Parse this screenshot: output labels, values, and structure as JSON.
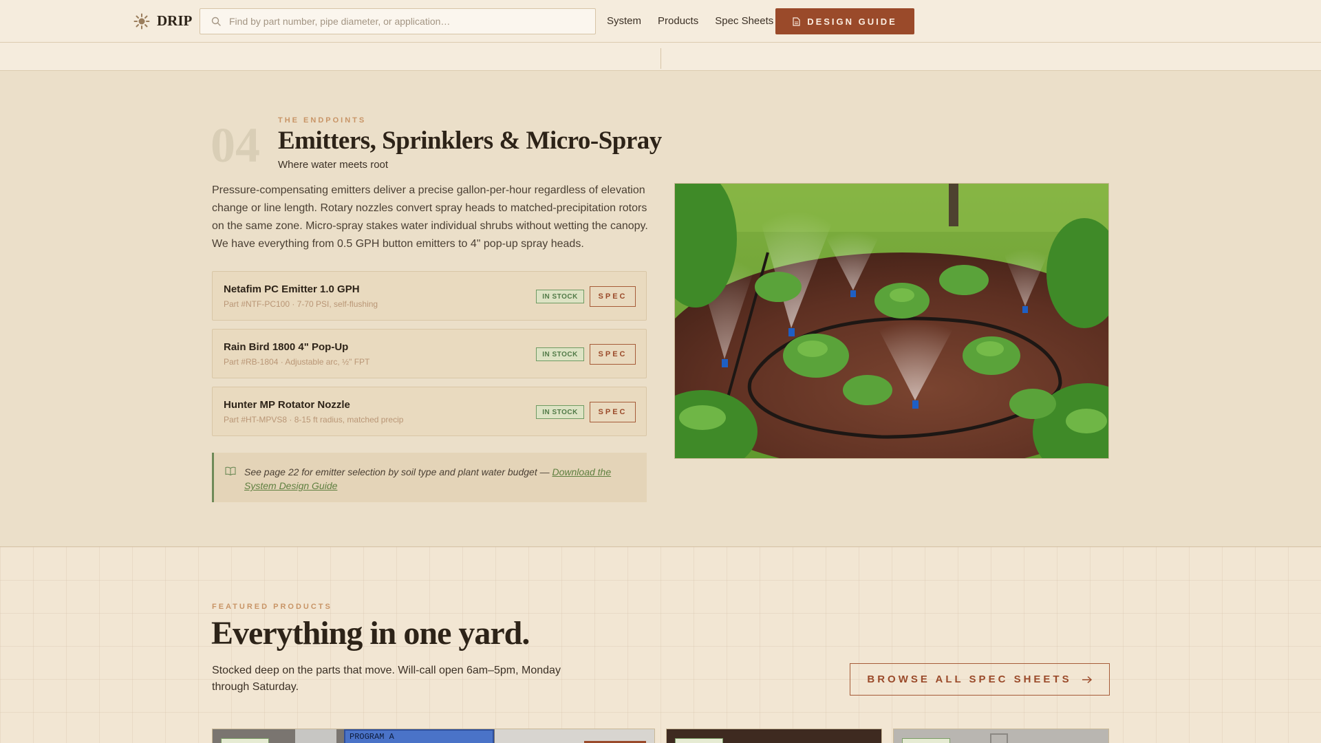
{
  "header": {
    "logo_text": "DRIP",
    "search_placeholder": "Find by part number, pipe diameter, or application…",
    "nav": [
      "System",
      "Products",
      "Spec Sheets"
    ],
    "cta_label": "DESIGN GUIDE"
  },
  "section": {
    "number": "04",
    "eyebrow": "THE ENDPOINTS",
    "title": "Emitters, Sprinklers & Micro-Spray",
    "subtitle": "Where water meets root",
    "description": "Pressure-compensating emitters deliver a precise gallon-per-hour regardless of elevation change or line length. Rotary nozzles convert spray heads to matched-precipitation rotors on the same zone. Micro-spray stakes water individual shrubs without wetting the canopy. We have everything from 0.5 GPH button emitters to 4\" pop-up spray heads.",
    "products": [
      {
        "name": "Netafim PC Emitter 1.0 GPH",
        "meta": "Part #NTF-PC100 · 7-70 PSI, self-flushing",
        "stock": "IN STOCK",
        "spec": "SPEC"
      },
      {
        "name": "Rain Bird 1800 4\" Pop-Up",
        "meta": "Part #RB-1804 · Adjustable arc, ½\" FPT",
        "stock": "IN STOCK",
        "spec": "SPEC"
      },
      {
        "name": "Hunter MP Rotator Nozzle",
        "meta": "Part #HT-MPVS8 · 8-15 ft radius, matched precip",
        "stock": "IN STOCK",
        "spec": "SPEC"
      }
    ],
    "note": {
      "text": "See page 22 for emitter selection by soil type and plant water budget — ",
      "link": "Download the System Design Guide"
    }
  },
  "featured": {
    "eyebrow": "FEATURED PRODUCTS",
    "title": "Everything in one yard.",
    "description": "Stocked deep on the parts that move. Will-call open 6am–5pm, Monday through Saturday.",
    "browse_label": "BROWSE ALL SPEC SHEETS",
    "controller_display": "PROGRAM A"
  },
  "colors": {
    "accent": "#9a4a2a",
    "stock_green": "#517a47",
    "page_bg": "#ebdfc9",
    "eyebrow": "#c89466"
  }
}
